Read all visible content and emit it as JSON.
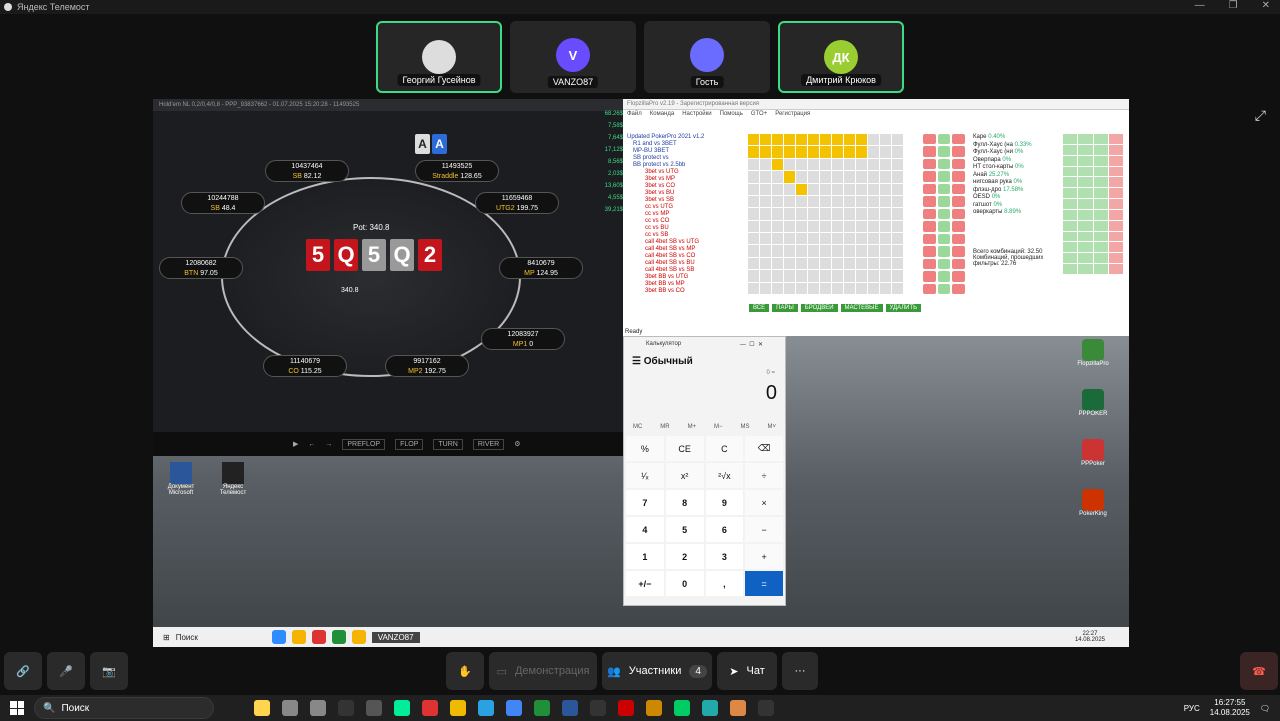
{
  "app": {
    "title": "Яндекс Телемост"
  },
  "participants": [
    {
      "name": "Георгий Гусейнов",
      "initials": "",
      "color": "#111111",
      "speaking": true
    },
    {
      "name": "VANZO87",
      "initials": "V",
      "color": "#6a4cff",
      "speaking": false
    },
    {
      "name": "Гость",
      "initials": "",
      "color": "#6a6cff",
      "speaking": false
    },
    {
      "name": "Дмитрий Крюков",
      "initials": "ДК",
      "color": "#9acd32",
      "speaking": true
    }
  ],
  "poker": {
    "header": "Hold'em NL 0,2/0,4/0,8 - PPP_93837662 - 01.07.2025 15:20:28 - 11493525",
    "pot_label": "Pot:",
    "pot": "340.8",
    "pot_small": "340.8",
    "board": [
      "5",
      "Q",
      "5",
      "Q",
      "2"
    ],
    "hole": [
      "A",
      "A"
    ],
    "seats": [
      {
        "id": "10437464",
        "pos": "SB",
        "stack": "82.12"
      },
      {
        "id": "11493525",
        "pos": "Straddle",
        "stack": "128.65"
      },
      {
        "id": "10244788",
        "pos": "SB",
        "stack": "48.4"
      },
      {
        "id": "11659468",
        "pos": "UTG2",
        "stack": "199.75"
      },
      {
        "id": "12080682",
        "pos": "BTN",
        "stack": "97.05"
      },
      {
        "id": "8410679",
        "pos": "MP",
        "stack": "124.95"
      },
      {
        "id": "12083927",
        "pos": "MP1",
        "stack": "0"
      },
      {
        "id": "11140679",
        "pos": "CO",
        "stack": "115.25"
      },
      {
        "id": "9917162",
        "pos": "MP2",
        "stack": "192.75"
      }
    ],
    "side_stats": [
      "68.26$",
      "7,58$",
      "7,64$",
      "17,12$",
      "8,56$",
      "2,03$",
      "13,60$",
      "4,55$",
      "39,21$"
    ],
    "controls": [
      "PREFLOP",
      "FLOP",
      "TURN",
      "RIVER"
    ]
  },
  "flopzilla": {
    "title": "FlopzillaPro v2.19 - Зарегистрированная версия",
    "menu": [
      "Файл",
      "Команда",
      "Настройки",
      "Помощь",
      "GTO+",
      "Регистрация"
    ],
    "tree_title": "Updated PokerPro 2021 v1.2",
    "tree": [
      "R1 and vs 3BET",
      "MP-BU 3BET",
      "SB protect vs",
      "BB protect vs 2.5bb",
      "3bet vs UTG",
      "3bet vs MP",
      "3bet vs CO",
      "3bet vs BU",
      "3bet vs SB",
      "cc vs UTG",
      "cc vs MP",
      "cc vs CO",
      "cc vs BU",
      "cc vs SB",
      "call 4bet SB vs UTG",
      "call 4bet SB vs MP",
      "call 4bet SB vs CO",
      "call 4bet SB vs BU",
      "call 4bet SB vs SB",
      "3bet BB vs UTG",
      "3bet BB vs MP",
      "3bet BB vs CO"
    ],
    "stats": [
      "Каре",
      "Фулл-Хаус (на",
      "Фулл-Хаус (ни",
      "Оверпара",
      "HT стол-карты",
      "Анай",
      "нигсовая рука",
      "флэш-дро",
      "OESD",
      "гатшот",
      "оверкарты"
    ],
    "percents": [
      "0.40%",
      "0.33%",
      "0%",
      "0%",
      "0%",
      "25.27%",
      "0%",
      "17.58%",
      "0%",
      "0%",
      "8.89%"
    ],
    "summary": "Всего комбинаций: 32.50",
    "filter": "Комбинаций, прошедших фильтры: 22.76",
    "buttons": [
      "ВСЕ",
      "ПАРЫ",
      "БРОДВЕЙ",
      "МАСТЕВЫЕ",
      "УДАЛИТЬ"
    ],
    "ready": "Ready"
  },
  "calculator": {
    "title": "Калькулятор",
    "mode": "Обычный",
    "display": "0",
    "history": "0 =",
    "memory": [
      "MC",
      "MR",
      "M+",
      "M−",
      "MS",
      "M˅"
    ],
    "keys": [
      "%",
      "CE",
      "C",
      "⌫",
      "¹⁄ₓ",
      "x²",
      "²√x",
      "÷",
      "7",
      "8",
      "9",
      "×",
      "4",
      "5",
      "6",
      "−",
      "1",
      "2",
      "3",
      "+",
      "+/−",
      "0",
      ",",
      "="
    ]
  },
  "desktop": {
    "left_icons": [
      "Документ Microsoft",
      "Яндекс Телемост"
    ],
    "right_icons": [
      "FlopzillaPro",
      "PPPOKER",
      "PPPoker",
      "PokerKing"
    ],
    "taskbar_search": "Поиск",
    "taskbar_active": "VANZO87",
    "lang": "РУС",
    "time": "22:27",
    "date": "14.08.2025"
  },
  "controls": {
    "demo_label": "Демонстрация",
    "participants_label": "Участники",
    "participants_count": "4",
    "chat_label": "Чат"
  },
  "os_taskbar": {
    "search": "Поиск",
    "lang": "РУС",
    "time": "16:27:55",
    "date": "14.08.2025"
  }
}
